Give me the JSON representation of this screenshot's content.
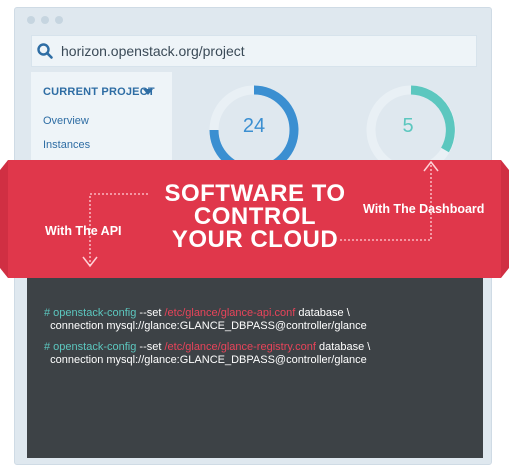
{
  "url": "horizon.openstack.org/project",
  "sidebar": {
    "header": "CURRENT PROJECT",
    "items": [
      "Overview",
      "Instances"
    ]
  },
  "stats": {
    "ring1_value": "24",
    "ring2_value": "5"
  },
  "banner": {
    "headline_1": "SOFTWARE TO",
    "headline_2": "CONTROL",
    "headline_3": "YOUR CLOUD",
    "label_api": "With The API",
    "label_dashboard": "With The Dashboard"
  },
  "code": {
    "cmd1_comment": "# openstack-config",
    "cmd1_flag": " --set ",
    "cmd1_path": "/etc/glance/glance-api.conf",
    "cmd1_rest": " database \\",
    "cmd1_line2": "  connection mysql://glance:GLANCE_DBPASS@controller/glance",
    "cmd2_comment": "# openstack-config",
    "cmd2_flag": " --set ",
    "cmd2_path": "/etc/glance/glance-registry.conf",
    "cmd2_rest": " database \\",
    "cmd2_line2": "  connection mysql://glance:GLANCE_DBPASS@controller/glance"
  },
  "colors": {
    "accent_red": "#e0374b",
    "ring_blue": "#3b8fd1",
    "ring_teal": "#5cc7bf",
    "link_blue": "#2e6da4",
    "code_bg": "#3d4246"
  }
}
